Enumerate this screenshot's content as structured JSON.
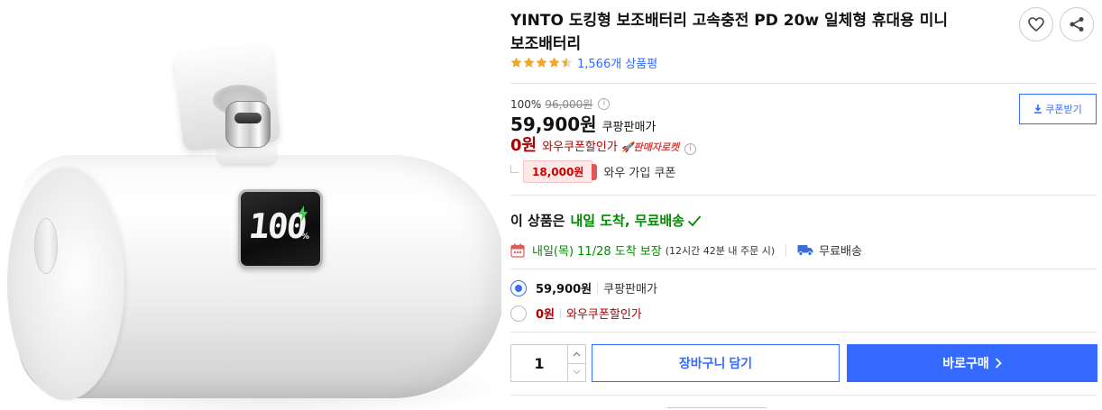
{
  "image": {
    "display_value": "100",
    "display_unit": "%"
  },
  "product": {
    "title": "YINTO 도킹형 보조배터리 고속충전 PD 20w 일체형 휴대용 미니 보조배터리",
    "rating": 4.5,
    "review_count": "1,566개 상품평"
  },
  "price": {
    "discount_rate": "100%",
    "original_price": "96,000원",
    "sale_price": "59,900원",
    "seller_type": "쿠팡판매가",
    "coupon_price": "0원",
    "coupon_label": "와우쿠폰할인가",
    "rocket_badge": "🚀판매자로켓",
    "wow_amount": "18,000원",
    "wow_label": "와우 가입 쿠폰",
    "info_glyph": "i"
  },
  "coupon_button": {
    "label": "쿠폰받기"
  },
  "delivery": {
    "headline_prefix": "이 상품은",
    "headline_highlight": "내일 도착, 무료배송",
    "date": "내일(목) 11/28 도착 보장",
    "note": "(12시간 42분 내 주문 시)",
    "free_shipping": "무료배송"
  },
  "options": [
    {
      "price": "59,900원",
      "label": "쿠팡판매가",
      "selected": true
    },
    {
      "price": "0원",
      "label": "와우쿠폰할인가",
      "selected": false
    }
  ],
  "purchase": {
    "quantity": "1",
    "cart_label": "장바구니 담기",
    "buy_label": "바로구매"
  },
  "colors": {
    "accent_blue": "#346aff",
    "price_red": "#ae0000",
    "delivery_green": "#008c00",
    "star_orange": "#f5a623"
  },
  "icons": [
    "heart-icon",
    "share-icon",
    "star-icon",
    "info-icon",
    "download-icon",
    "check-icon",
    "calendar-icon",
    "truck-icon",
    "chevron-up-icon",
    "chevron-down-icon",
    "arrow-right-icon",
    "lightning-icon"
  ]
}
